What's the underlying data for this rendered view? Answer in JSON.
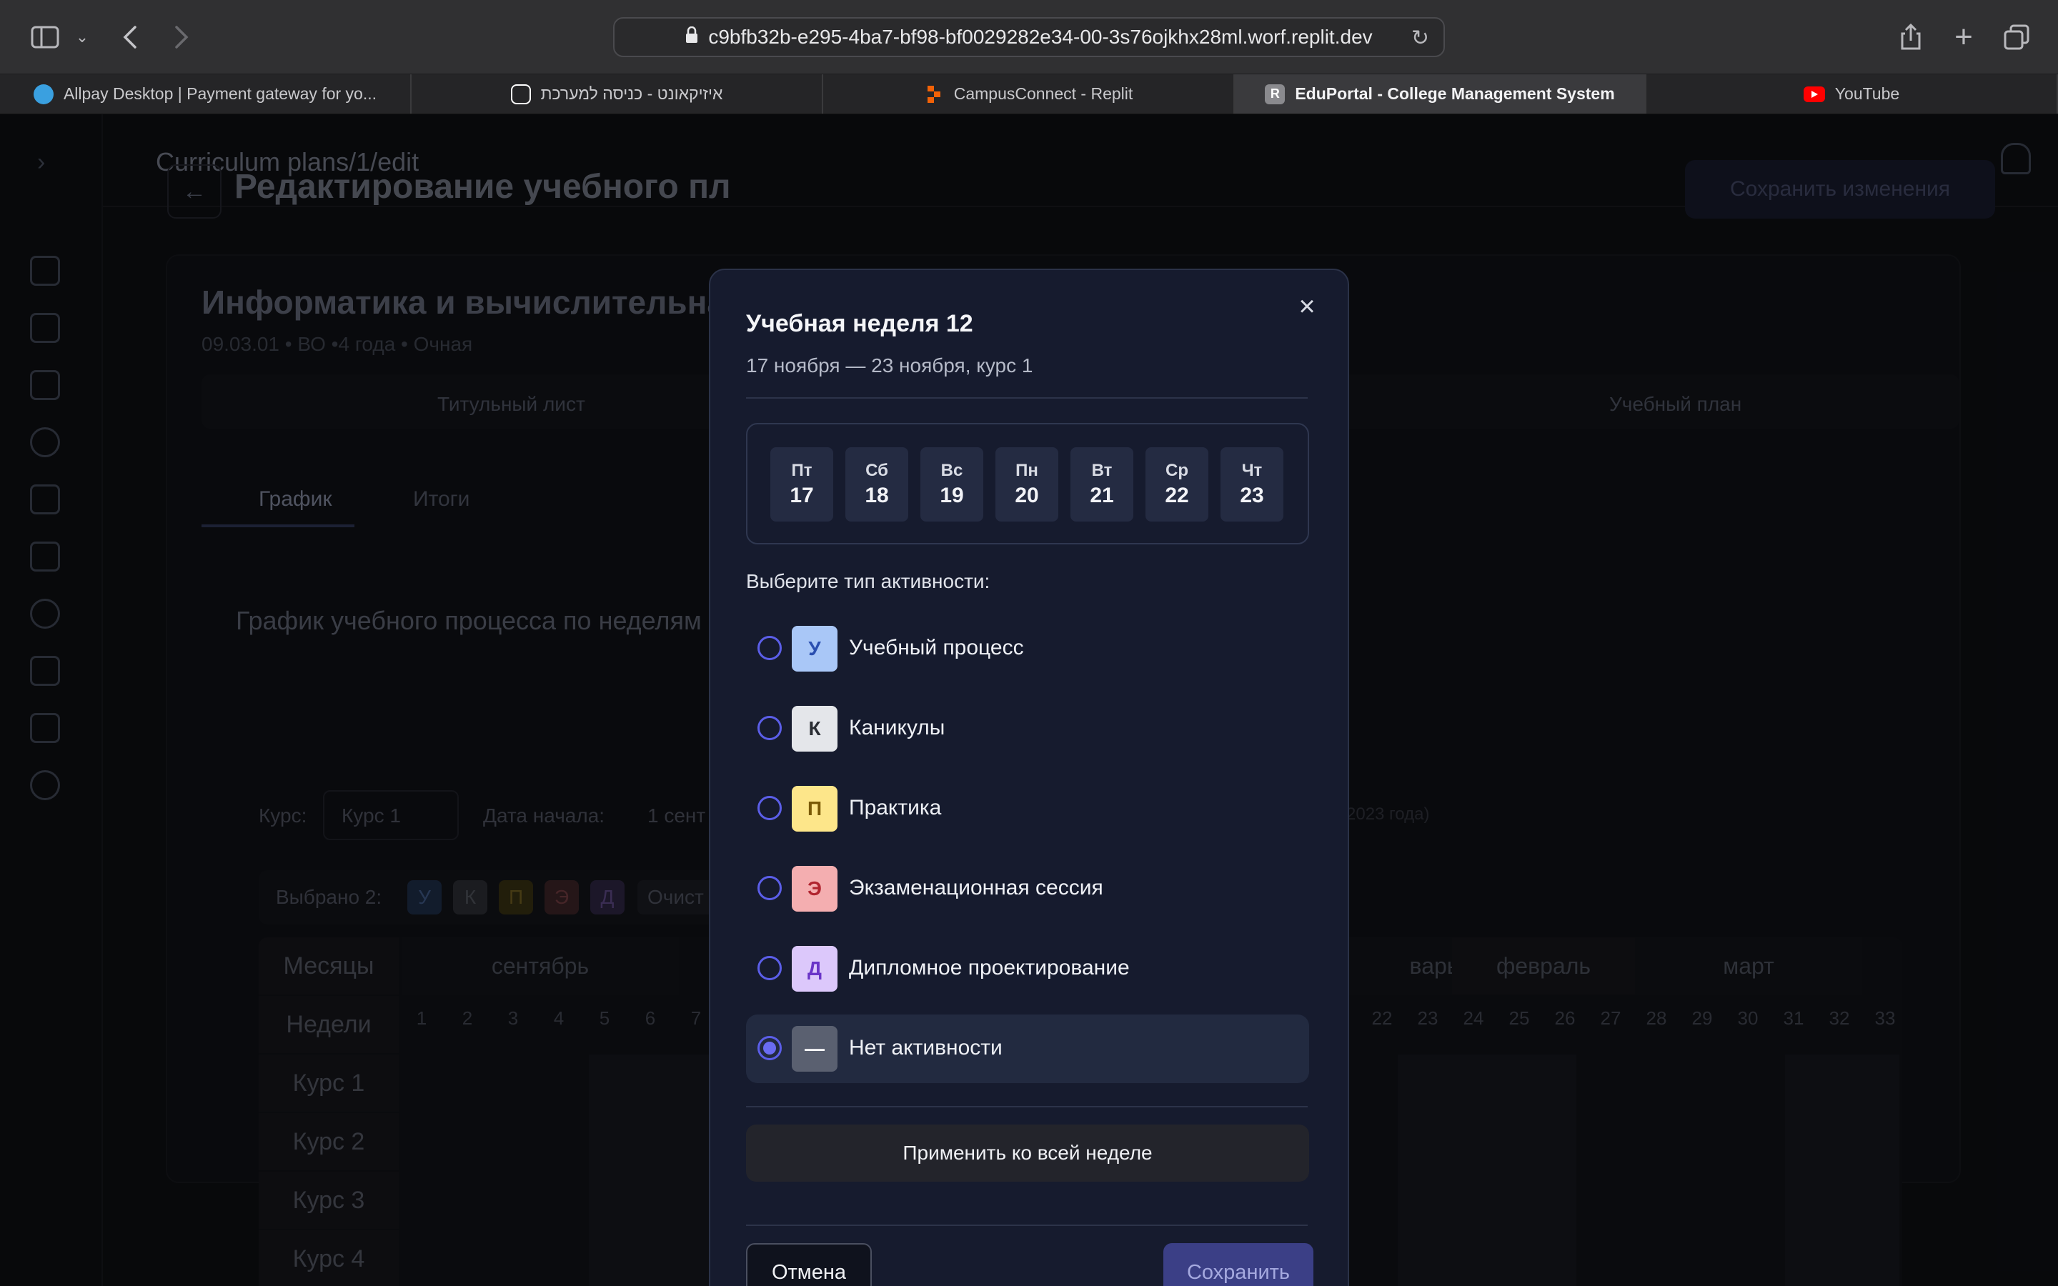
{
  "browser": {
    "url": "c9bfb32b-e295-4ba7-bf98-bf0029282e34-00-3s76ojkhx28ml.worf.replit.dev",
    "tabs": [
      {
        "label": "Allpay Desktop | Payment gateway for yo...",
        "icon": "allpay-icon",
        "color": "#3aa0e0"
      },
      {
        "label": "איזיקאונט - כניסה למערכת",
        "icon": "ezcount-icon",
        "color": "#ffffff"
      },
      {
        "label": "CampusConnect - Replit",
        "icon": "replit-icon",
        "color": "#f26207"
      },
      {
        "label": "EduPortal - College Management System",
        "icon": "eduportal-icon",
        "color": "#8a8a8e",
        "letter": "R",
        "active": true
      },
      {
        "label": "YouTube",
        "icon": "youtube-icon",
        "color": "#ff0000"
      }
    ]
  },
  "app": {
    "breadcrumb": "Curriculum plans/1/edit",
    "page_title": "Редактирование учебного пл",
    "save_changes_label": "Сохранить изменения",
    "program_title": "Информатика и вычислительная",
    "program_meta": "09.03.01 • ВО •4 года • Очная",
    "doc_tabs": [
      "Титульный лист",
      "Учебный план"
    ],
    "view_tabs": [
      "График",
      "Итоги"
    ],
    "section_title": "График учебного процесса по неделям",
    "filters": {
      "course_label": "Курс:",
      "course_value": "Курс 1",
      "start_label": "Дата начала:",
      "start_value": "1 сент",
      "year_hint": "2023 года)"
    },
    "selected": {
      "label": "Выбрано 2:",
      "chips": [
        "У",
        "К",
        "П",
        "Э",
        "Д"
      ],
      "clear_label": "Очист"
    },
    "grid": {
      "months_header": "Месяцы",
      "weeks_header": "Недели",
      "months": [
        "сентябрь",
        "варь",
        "февраль",
        "март"
      ],
      "weeks_left": [
        "1",
        "2",
        "3",
        "4",
        "5",
        "6",
        "7"
      ],
      "weeks_right": [
        "22",
        "23",
        "24",
        "25",
        "26",
        "27",
        "28",
        "29",
        "30",
        "31",
        "32",
        "33"
      ],
      "courses": [
        "Курс 1",
        "Курс 2",
        "Курс 3",
        "Курс 4"
      ]
    }
  },
  "modal": {
    "title": "Учебная неделя 12",
    "subtitle": "17 ноября — 23 ноября, курс 1",
    "days": [
      {
        "name": "Пт",
        "date": "17"
      },
      {
        "name": "Сб",
        "date": "18"
      },
      {
        "name": "Вс",
        "date": "19"
      },
      {
        "name": "Пн",
        "date": "20"
      },
      {
        "name": "Вт",
        "date": "21"
      },
      {
        "name": "Ср",
        "date": "22"
      },
      {
        "name": "Чт",
        "date": "23"
      }
    ],
    "prompt": "Выберите тип активности:",
    "options": [
      {
        "code": "У",
        "label": "Учебный процесс",
        "bg": "#a9c7f7",
        "fg": "#2b4fb0",
        "selected": false
      },
      {
        "code": "К",
        "label": "Каникулы",
        "bg": "#e4e6ea",
        "fg": "#2a2d33",
        "selected": false
      },
      {
        "code": "П",
        "label": "Практика",
        "bg": "#fde68a",
        "fg": "#7a5a06",
        "selected": false
      },
      {
        "code": "Э",
        "label": "Экзаменационная сессия",
        "bg": "#f4aeb0",
        "fg": "#b1242f",
        "selected": false
      },
      {
        "code": "Д",
        "label": "Дипломное проектирование",
        "bg": "#dcc8fb",
        "fg": "#6a35c8",
        "selected": false
      },
      {
        "code": "—",
        "label": "Нет активности",
        "bg": "#5a6070",
        "fg": "#ffffff",
        "selected": true
      }
    ],
    "apply_label": "Применить ко всей неделе",
    "cancel_label": "Отмена",
    "save_label": "Сохранить"
  }
}
